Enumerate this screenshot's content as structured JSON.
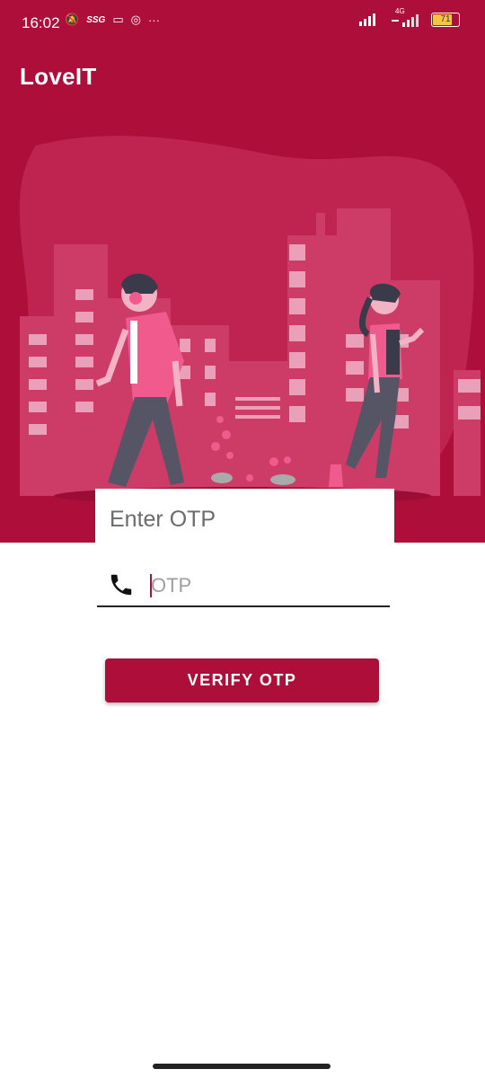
{
  "status_bar": {
    "time": "16:02",
    "network": "4G",
    "battery_level": "71",
    "icons": [
      "alarm-off-icon",
      "ssg-icon",
      "cast-icon",
      "instagram-icon",
      "more-dots-icon",
      "signal-icon",
      "wifi-icon",
      "battery-icon"
    ]
  },
  "app_bar": {
    "title": "LoveIT"
  },
  "card": {
    "title": "Enter OTP"
  },
  "otp_field": {
    "placeholder": "OTP",
    "value": "",
    "icon": "phone-icon"
  },
  "verify_button": {
    "label": "VERIFY OTP"
  },
  "colors": {
    "primary": "#ad0f3a",
    "accent_pink": "#f05a8c"
  }
}
